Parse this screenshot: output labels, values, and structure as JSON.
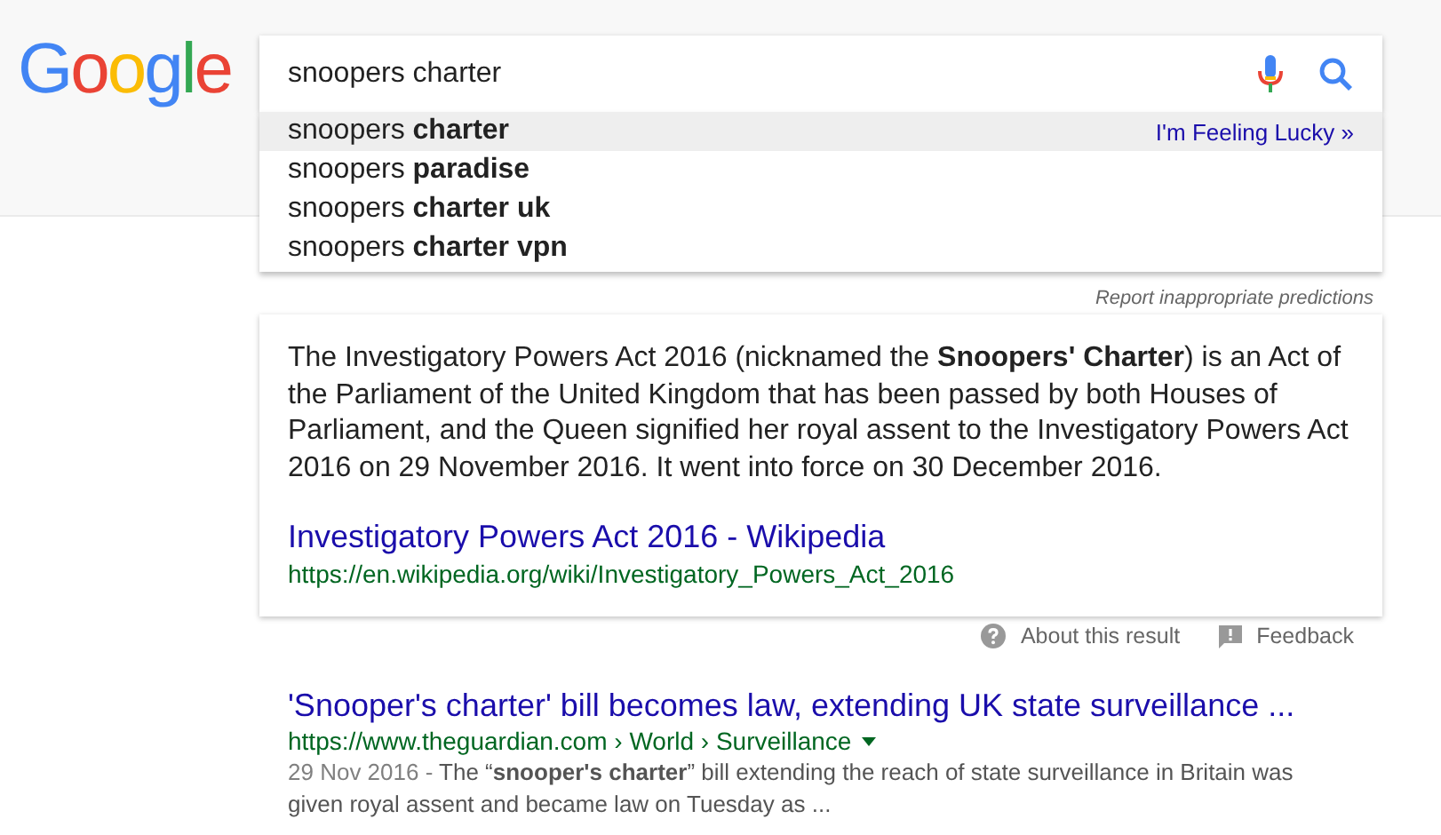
{
  "logo": {
    "text": "Google"
  },
  "search": {
    "value": "snoopers charter"
  },
  "suggestions": [
    {
      "text": "snoopers **charter**",
      "selected": true
    },
    {
      "text": "snoopers **paradise**",
      "selected": false
    },
    {
      "text": "snoopers **charter uk**",
      "selected": false
    },
    {
      "text": "snoopers **charter vpn**",
      "selected": false
    }
  ],
  "lucky_link": "I'm Feeling Lucky »",
  "report_link": "Report inappropriate predictions",
  "featured_snippet": {
    "text": "The Investigatory Powers Act 2016 (nicknamed the **Snoopers' Charter**) is an Act of the Parliament of the United Kingdom that has been passed by both Houses of Parliament, and the Queen signified her royal assent to the Investigatory Powers Act 2016 on 29 November 2016. It went into force on 30 December 2016.",
    "link_title": "Investigatory Powers Act 2016 - Wikipedia",
    "url": "https://en.wikipedia.org/wiki/Investigatory_Powers_Act_2016"
  },
  "about_link": "About this result",
  "feedback_link": "Feedback",
  "results": [
    {
      "title": "'Snooper's charter' bill becomes law, extending UK state surveillance ...",
      "url": "https://www.theguardian.com › World › Surveillance",
      "date": "29 Nov 2016 - ",
      "snippet": "The “**snooper's charter**” bill extending the reach of state surveillance in Britain was given royal assent and became law on Tuesday as ..."
    }
  ]
}
